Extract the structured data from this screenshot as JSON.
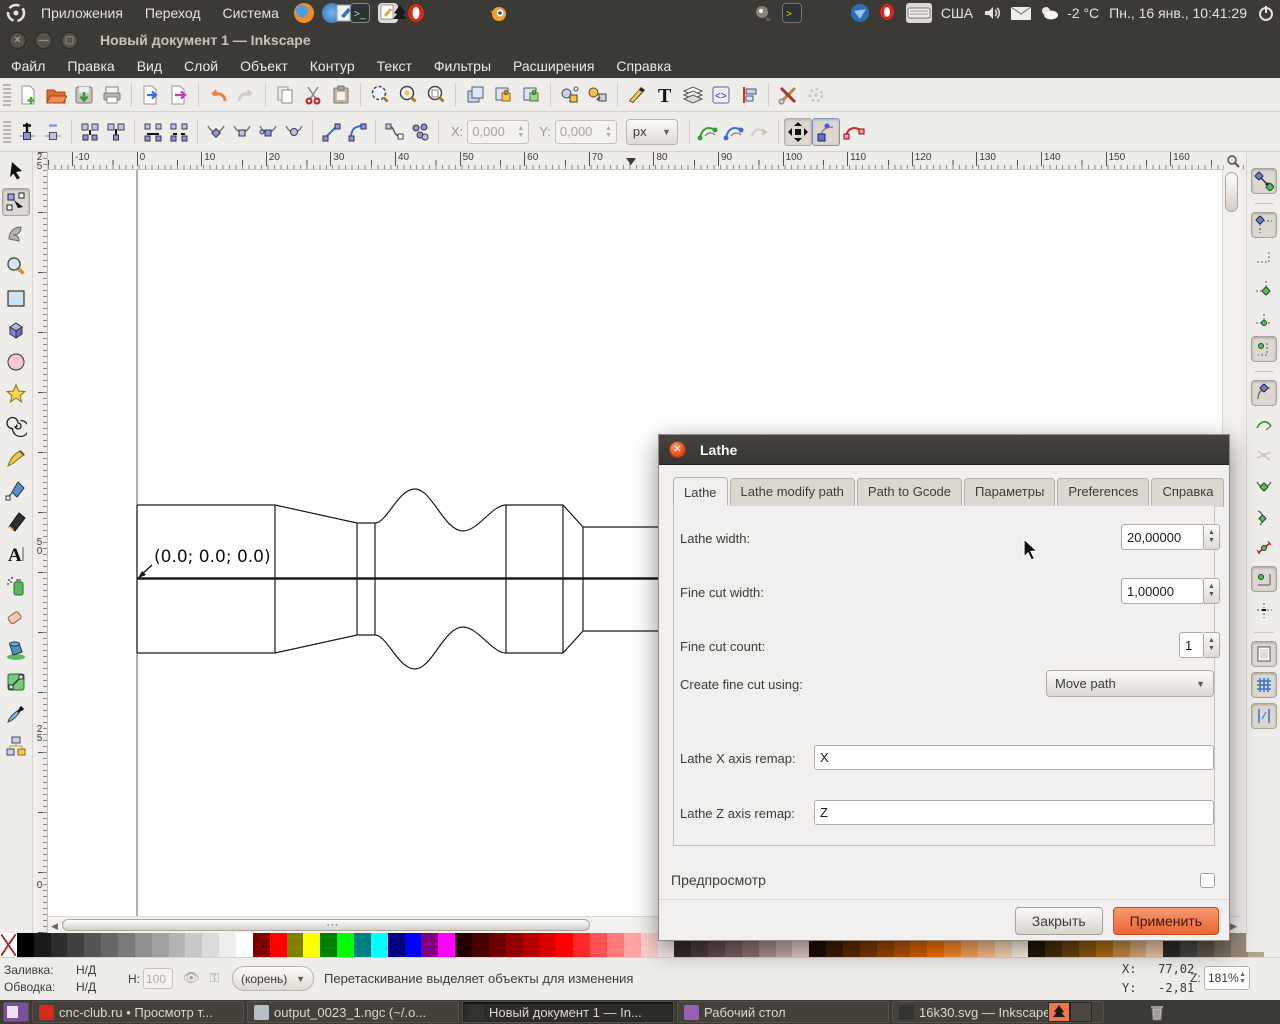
{
  "colors": {
    "accent": "#f0764b",
    "panel": "#3b3a35",
    "toolbar": "#efedea",
    "apply_button": "#ec6434"
  },
  "desktop": {
    "panel_menus": [
      "Приложения",
      "Переход",
      "Система"
    ],
    "tray": {
      "keyboard_layout": "США",
      "temperature": "-2 °C",
      "clock": "Пн., 16 янв., 10:41:29"
    },
    "taskbar_items": [
      {
        "label": "cnc-club.ru • Просмотр т...",
        "icon": "opera-icon",
        "color": "#d8281c",
        "active": false
      },
      {
        "label": "output_0023_1.ngc (~/.o...",
        "icon": "text-editor-icon",
        "color": "#b8bec4",
        "active": false
      },
      {
        "label": "Новый документ 1 — In...",
        "icon": "inkscape-icon",
        "color": "#333",
        "active": true
      },
      {
        "label": "Рабочий стол",
        "icon": "desktop-icon",
        "color": "#9a5fb5",
        "active": false
      },
      {
        "label": "16k30.svg — Inkscape",
        "icon": "inkscape-icon",
        "color": "#333",
        "active": false
      }
    ]
  },
  "window": {
    "title": "Новый документ 1 — Inkscape",
    "menubar": [
      "Файл",
      "Правка",
      "Вид",
      "Слой",
      "Объект",
      "Контур",
      "Текст",
      "Фильтры",
      "Расширения",
      "Справка"
    ],
    "command_icons": [
      "new-document",
      "open",
      "save",
      "print",
      "import",
      "export",
      "undo",
      "redo",
      "copy",
      "cut",
      "paste",
      "zoom-selection",
      "zoom-drawing",
      "zoom-page",
      "duplicate",
      "clone",
      "unlink-clone",
      "group",
      "ungroup",
      "fill-stroke",
      "text-dialog",
      "layers",
      "xml-editor",
      "align",
      "preferences",
      "document-properties"
    ],
    "node_toolbar_icons": [
      "insert-node",
      "delete-node",
      "break-node",
      "join-nodes",
      "join-segment",
      "delete-segment",
      "corner-node",
      "smooth-node",
      "symmetric-node",
      "auto-node",
      "line-segment",
      "curve-segment",
      "object-to-path",
      "flatten-path",
      "x-coord",
      "y-coord",
      "unit",
      "edit-clip",
      "edit-mask",
      "next-lpe",
      "show-transform-handles",
      "show-bezier-handles",
      "show-outline"
    ]
  },
  "node_toolbar": {
    "x_label": "X:",
    "x_value": "0,000",
    "y_label": "Y:",
    "y_value": "0,000",
    "unit": "px"
  },
  "ruler": {
    "h_labels": [
      "-10",
      "0",
      "10",
      "20",
      "30",
      "40",
      "50",
      "60",
      "70",
      "80",
      "90",
      "100",
      "110",
      "120",
      "130",
      "140",
      "150",
      "160"
    ],
    "v_labels": [
      "50",
      "25",
      "0",
      "25"
    ]
  },
  "canvas": {
    "annotation": "(0.0; 0.0; 0.0)"
  },
  "dialog": {
    "title": "Lathe",
    "tabs": [
      {
        "label": "Lathe",
        "active": true
      },
      {
        "label": "Lathe modify path",
        "active": false
      },
      {
        "label": "Path to Gcode",
        "active": false
      },
      {
        "label": "Параметры",
        "active": false
      },
      {
        "label": "Preferences",
        "active": false
      },
      {
        "label": "Справка",
        "active": false
      }
    ],
    "rows": [
      {
        "label": "Lathe width:",
        "value": "20,00000"
      },
      {
        "label": "Fine cut width:",
        "value": "1,00000"
      },
      {
        "label": "Fine cut count:",
        "value": "1"
      },
      {
        "label": "Create fine cut using:",
        "value": "Move path"
      },
      {
        "label": "Lathe X axis remap:",
        "value": "X"
      },
      {
        "label": "Lathe Z axis remap:",
        "value": "Z"
      }
    ],
    "preview_label": "Предпросмотр",
    "buttons": {
      "close": "Закрыть",
      "apply": "Применить"
    }
  },
  "statusbar": {
    "fill_label": "Заливка:",
    "stroke_label": "Обводка:",
    "fill_value": "Н/Д",
    "stroke_value": "Н/Д",
    "opacity_label": "Н:",
    "opacity_value": "100",
    "layer": "(корень)",
    "message": "Перетаскивание выделяет объекты для изменения",
    "x_line": "X:   77,02",
    "y_line": "Y:   -2,81",
    "z_label": "Z:",
    "zoom": "181%"
  },
  "toolbox_tools": [
    "selector",
    "node-editor",
    "tweak",
    "zoom",
    "rectangle",
    "box-3d",
    "ellipse",
    "star",
    "spiral",
    "pencil",
    "bezier-pen",
    "calligraphy",
    "text",
    "spray",
    "eraser",
    "paint-bucket",
    "gradient",
    "dropper",
    "connector"
  ],
  "snap_icons": [
    "snap-enable",
    "snap-bbox",
    "snap-bbox-edge",
    "snap-bbox-corner",
    "snap-bbox-midpoint",
    "snap-bbox-center",
    "snap-nodes",
    "snap-path",
    "snap-intersection",
    "snap-cusp-node",
    "snap-smooth-node",
    "snap-midpoint",
    "snap-object-center",
    "snap-rotation-center",
    "snap-page-border",
    "snap-grid",
    "snap-guide"
  ],
  "palette_colors": [
    "none",
    "#000000",
    "#1a1a1a",
    "#2d2d2d",
    "#404040",
    "#545454",
    "#676767",
    "#7a7a7a",
    "#8e8e8e",
    "#a1a1a1",
    "#b4b4b4",
    "#c8c8c8",
    "#dbdbdb",
    "#eeeeee",
    "#ffffff",
    "#800000",
    "#ff0000",
    "#808000",
    "#ffff00",
    "#008000",
    "#00ff00",
    "#008080",
    "#00ffff",
    "#000080",
    "#0000ff",
    "#800080",
    "#ff00ff",
    "#240000",
    "#480000",
    "#6d0000",
    "#910000",
    "#b60000",
    "#da0000",
    "#ff0000",
    "#ff2929",
    "#ff5252",
    "#ff7b7b",
    "#ffa4a4",
    "#ffcdcd",
    "#f6eaea",
    "#332a28",
    "#4a3c3a",
    "#614e4c",
    "#786060",
    "#8f7372",
    "#ab908f",
    "#c7adac",
    "#e3cac9",
    "#1f0e00",
    "#3e1c00",
    "#5d2a00",
    "#7c3800",
    "#9b4600",
    "#ba5400",
    "#d96200",
    "#f87000",
    "#ff8b2e",
    "#ffa65c",
    "#ffc18a",
    "#ffdcb8",
    "#fff7e6",
    "#231604",
    "#462c08",
    "#69420c",
    "#8c5810",
    "#b06e14",
    "#c78c46",
    "#dcaa78",
    "#f1c8aa",
    "#2b2b26",
    "#45453d",
    "#60574a",
    "#7a6f5e",
    "#958a76",
    "#b0a48e"
  ]
}
